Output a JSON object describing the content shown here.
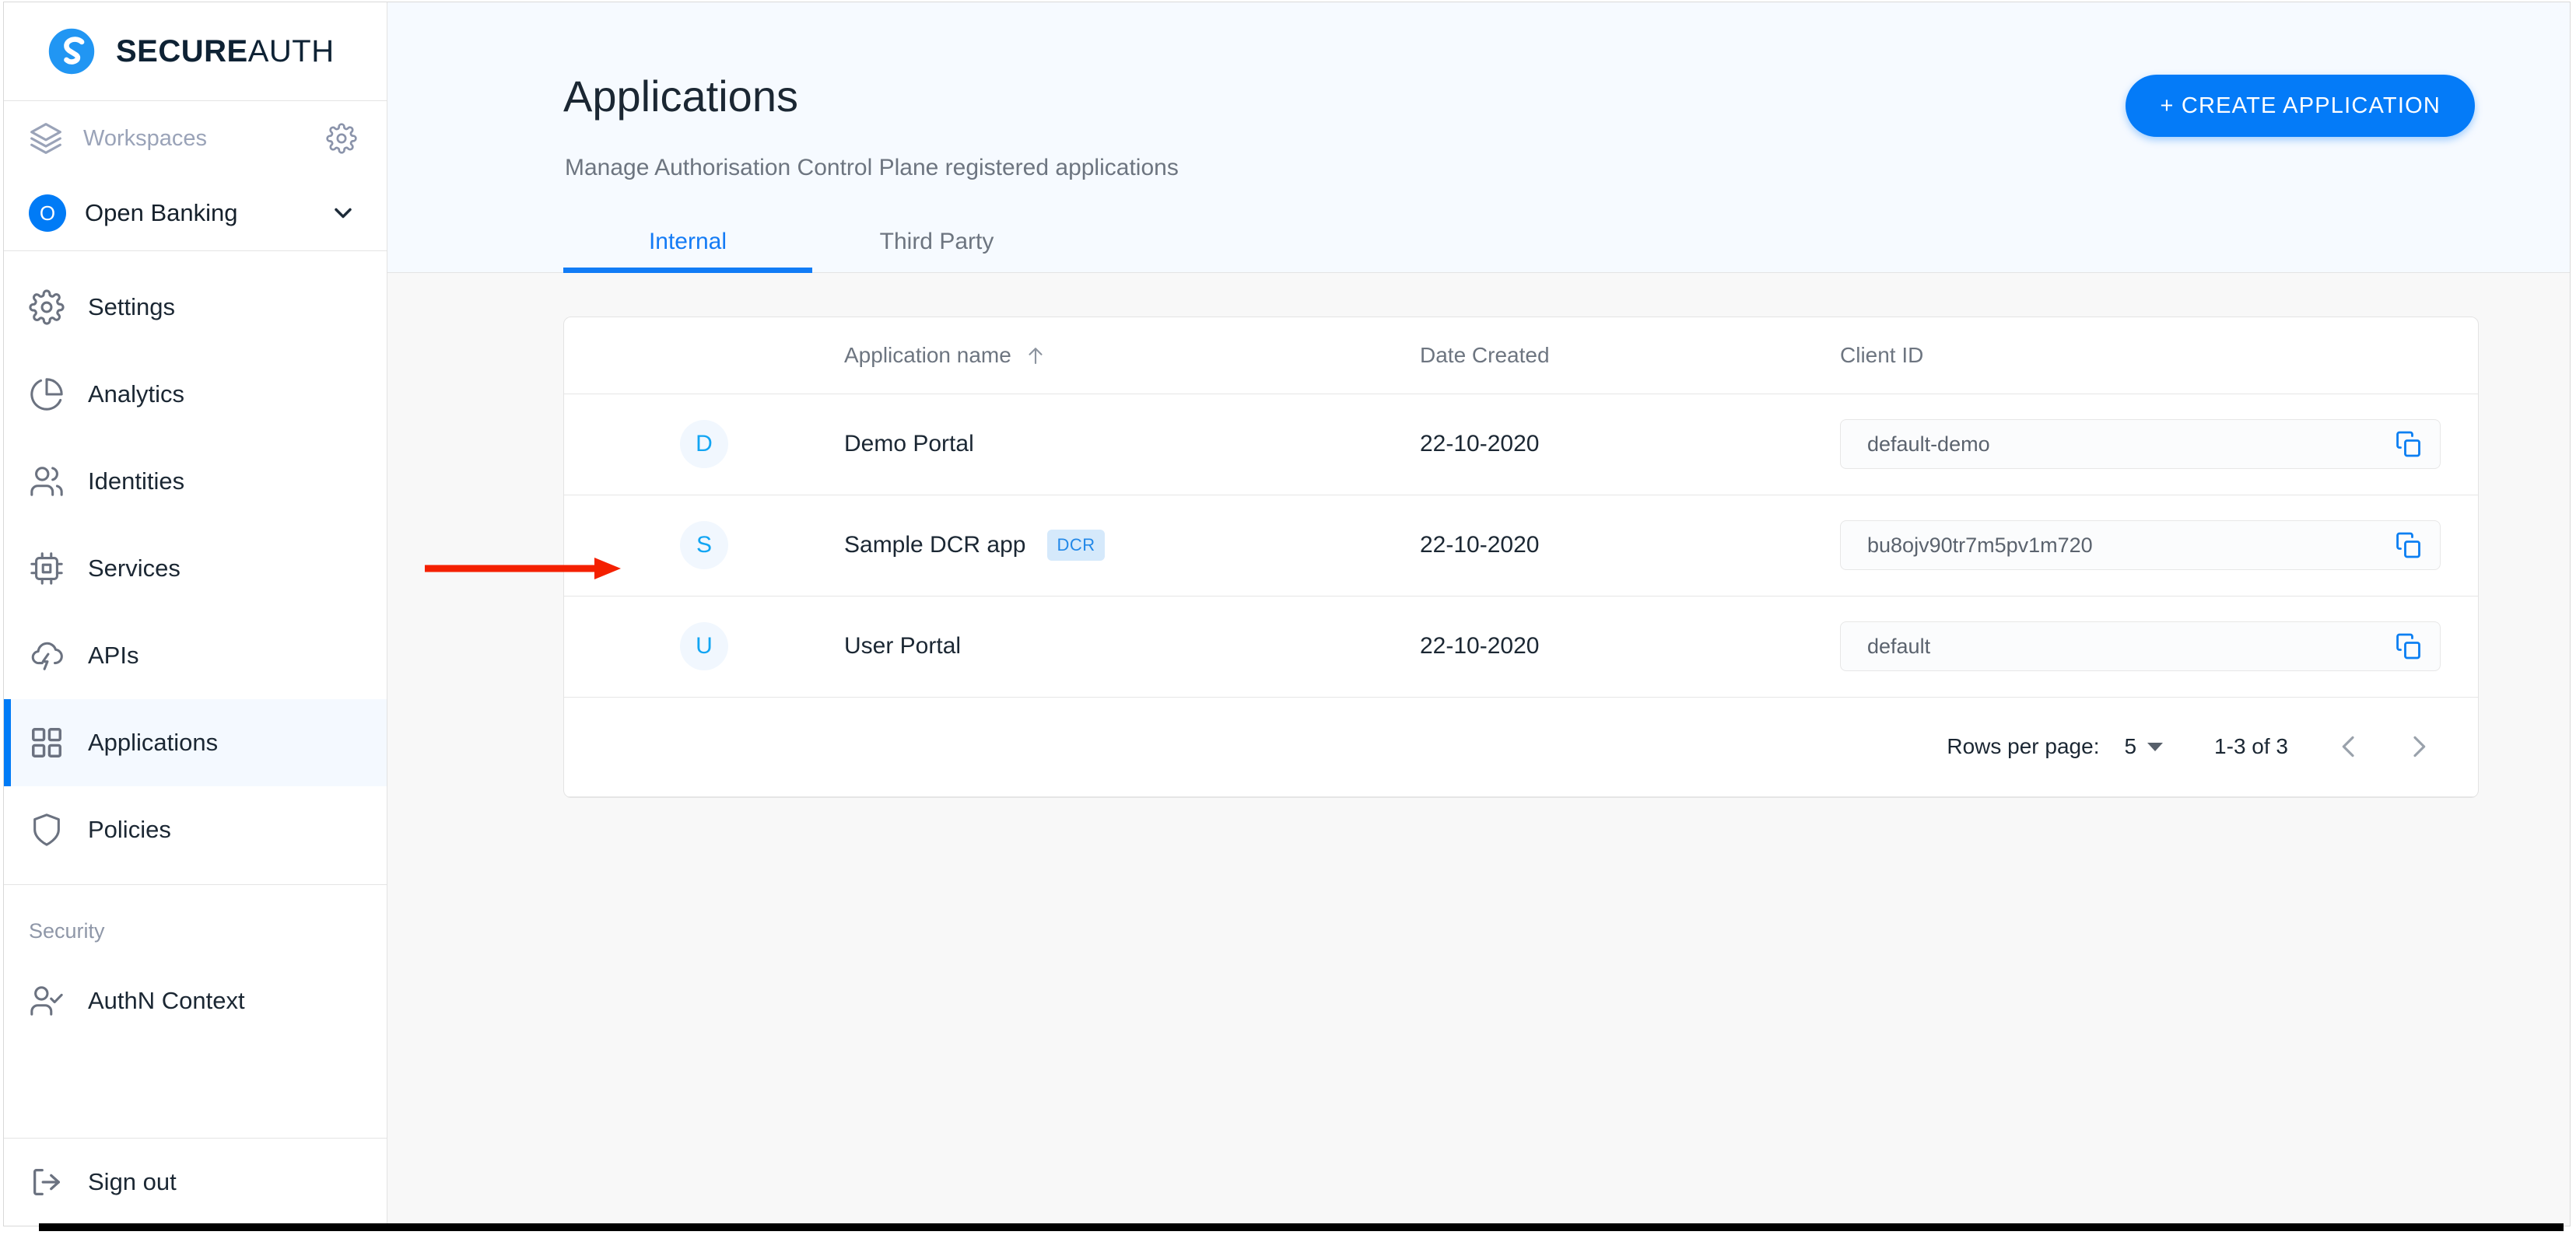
{
  "brand": {
    "name_bold": "SECURE",
    "name_light": "AUTH",
    "logo_color": "#2196F3"
  },
  "sidebar": {
    "workspaces_label": "Workspaces",
    "workspaces_icon": "layers-icon",
    "workspaces_settings_icon": "gear-icon",
    "workspace": {
      "initial": "O",
      "name": "Open Banking",
      "chevron_icon": "chevron-down-icon"
    },
    "items": [
      {
        "label": "Settings",
        "icon": "gear-icon",
        "active": false
      },
      {
        "label": "Analytics",
        "icon": "pie-chart-icon",
        "active": false
      },
      {
        "label": "Identities",
        "icon": "users-icon",
        "active": false
      },
      {
        "label": "Services",
        "icon": "chip-icon",
        "active": false
      },
      {
        "label": "APIs",
        "icon": "cloud-bolt-icon",
        "active": false
      },
      {
        "label": "Applications",
        "icon": "grid-icon",
        "active": true
      },
      {
        "label": "Policies",
        "icon": "shield-icon",
        "active": false
      }
    ],
    "security_section_label": "Security",
    "security_items": [
      {
        "label": "AuthN Context",
        "icon": "user-check-icon"
      }
    ],
    "signout": {
      "label": "Sign out",
      "icon": "logout-icon"
    }
  },
  "header": {
    "title": "Applications",
    "subtitle": "Manage Authorisation Control Plane registered applications",
    "create_button": "+ CREATE APPLICATION",
    "create_button_color": "#047bf8",
    "tabs": [
      {
        "label": "Internal",
        "active": true
      },
      {
        "label": "Third Party",
        "active": false
      }
    ]
  },
  "table": {
    "columns": [
      {
        "key": "avatar",
        "label": ""
      },
      {
        "key": "name",
        "label": "Application name",
        "sort": "asc",
        "sort_icon": "arrow-up-icon"
      },
      {
        "key": "date",
        "label": "Date Created"
      },
      {
        "key": "client",
        "label": "Client ID"
      }
    ],
    "rows": [
      {
        "initial": "D",
        "name": "Demo Portal",
        "badge": null,
        "date": "22-10-2020",
        "client_id": "default-demo",
        "copy_icon": "copy-icon"
      },
      {
        "initial": "S",
        "name": "Sample DCR app",
        "badge": "DCR",
        "date": "22-10-2020",
        "client_id": "bu8ojv90tr7m5pv1m720",
        "copy_icon": "copy-icon"
      },
      {
        "initial": "U",
        "name": "User Portal",
        "badge": null,
        "date": "22-10-2020",
        "client_id": "default",
        "copy_icon": "copy-icon"
      }
    ]
  },
  "pagination": {
    "rows_per_page_label": "Rows per page:",
    "rows_per_page_value": "5",
    "range_label": "1-3 of 3",
    "prev_icon": "chevron-left-icon",
    "next_icon": "chevron-right-icon"
  },
  "annotation": {
    "arrow_color": "#f42000",
    "points_to": "Sample DCR app"
  }
}
